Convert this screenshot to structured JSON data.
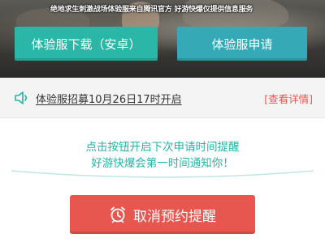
{
  "hero": {
    "tagline": "绝地求生刺激战场体验服来自腾讯官方 好游快爆仅提供信息服务",
    "download_label": "体验服下载（安卓）",
    "apply_label": "体验服申请"
  },
  "notice": {
    "icon": "speaker-icon",
    "text": "体验服招募10月26日17时开启",
    "link_label": "[查看详情]"
  },
  "reminder": {
    "line1": "点击按钮开启下次申请时间提醒",
    "line2": "好游快爆会第一时间通知你！",
    "cancel_label": "取消预约提醒",
    "cancel_icon": "alarm-clock-icon"
  },
  "colors": {
    "download_bg": "#2bb7a7",
    "apply_bg": "#35a9b6",
    "accent_teal": "#1fb6a6",
    "cancel_bg": "#e7574f",
    "link_red": "#e8574d"
  }
}
